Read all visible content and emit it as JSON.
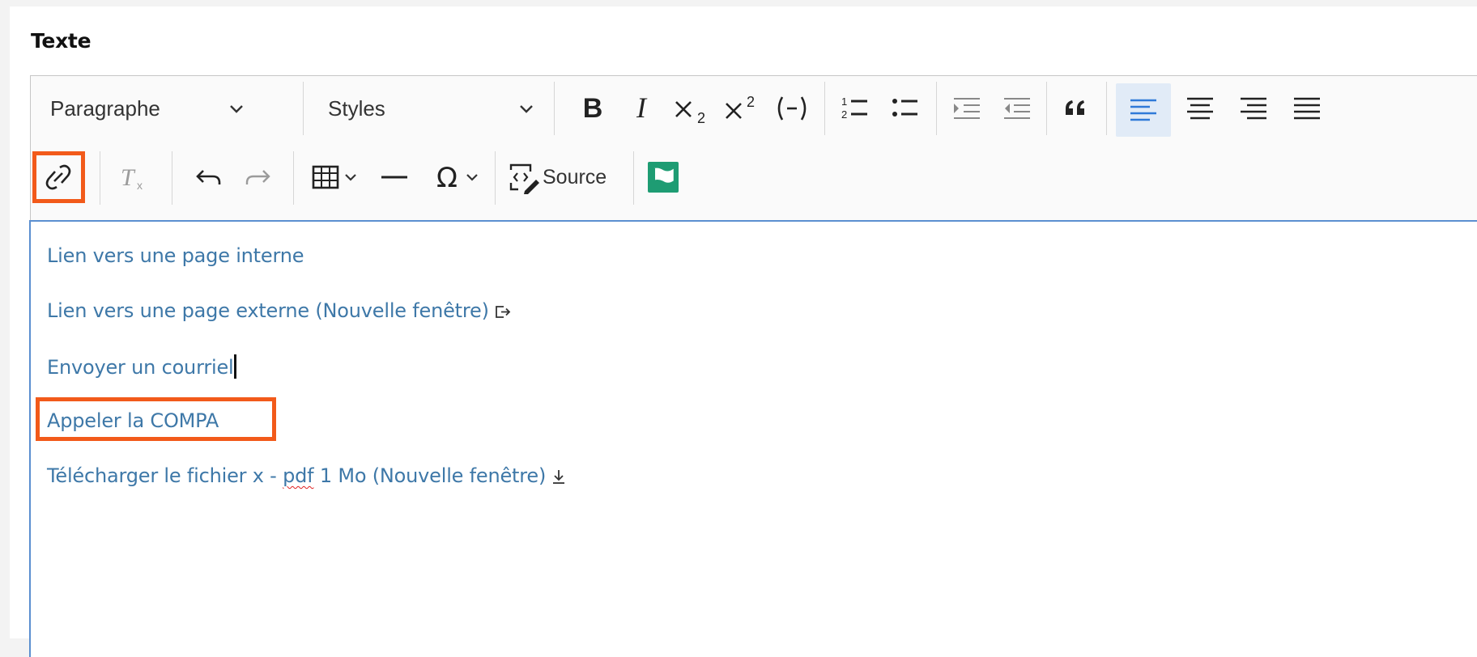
{
  "field": {
    "label": "Texte"
  },
  "toolbar": {
    "paragraph_dropdown": "Paragraphe",
    "styles_dropdown": "Styles",
    "source_label": "Source"
  },
  "icons": [
    "bold-icon",
    "italic-icon",
    "subscript-icon",
    "superscript-icon",
    "parentheses-icon",
    "numbered-list-icon",
    "bulleted-list-icon",
    "outdent-icon",
    "indent-icon",
    "blockquote-icon",
    "align-left-icon",
    "align-center-icon",
    "align-right-icon",
    "align-justify-icon",
    "link-icon",
    "remove-format-icon",
    "undo-icon",
    "redo-icon",
    "table-icon",
    "horizontal-line-icon",
    "special-character-icon",
    "source-icon",
    "flag-icon"
  ],
  "colors": {
    "highlight": "#f25a1a",
    "link": "#3e78a8",
    "focus_border": "#5b8fd0",
    "flag": "#1e9c73"
  },
  "content": {
    "lines": [
      "Lien vers une page interne",
      "Lien vers une page externe (Nouvelle fenêtre)",
      "Envoyer un courriel",
      "Appeler la COMPA",
      "Télécharger le fichier x - ",
      "pdf",
      " 1 Mo (Nouvelle fenêtre)"
    ]
  }
}
